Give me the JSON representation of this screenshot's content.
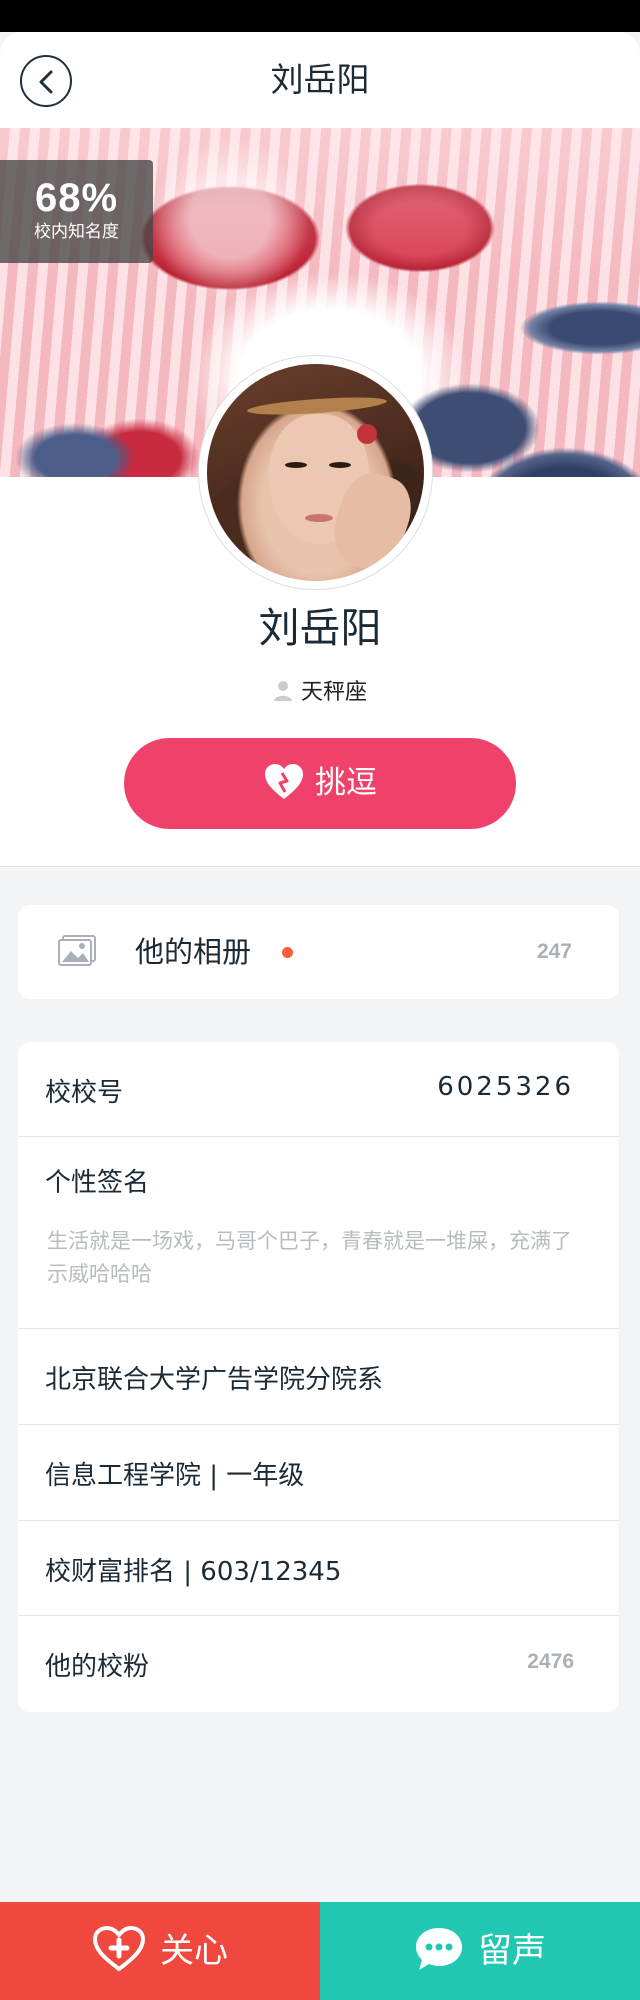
{
  "header": {
    "title": "刘岳阳"
  },
  "rank": {
    "value": "68%",
    "label": "校内知名度"
  },
  "profile": {
    "name": "刘岳阳",
    "zodiac": "天秤座",
    "action_label": "挑逗"
  },
  "album": {
    "label": "他的相册",
    "count": "247",
    "has_new": true
  },
  "info": {
    "school_id_label": "校校号",
    "school_id_value": "6025326",
    "signature_label": "个性签名",
    "signature_text": "生活就是一场戏，马哥个巴子，青春就是一堆屎，充满了示威哈哈哈",
    "school": "北京联合大学广告学院分院系",
    "department": "信息工程学院 | 一年级",
    "wealth_rank": "校财富排名 | 603/12345",
    "fans_label": "他的校粉",
    "fans_count": "2476"
  },
  "bottom": {
    "care_label": "关心",
    "message_label": "留声"
  },
  "colors": {
    "accent_pink": "#f0416a",
    "care_red": "#f0473f",
    "message_teal": "#21c7b1"
  }
}
